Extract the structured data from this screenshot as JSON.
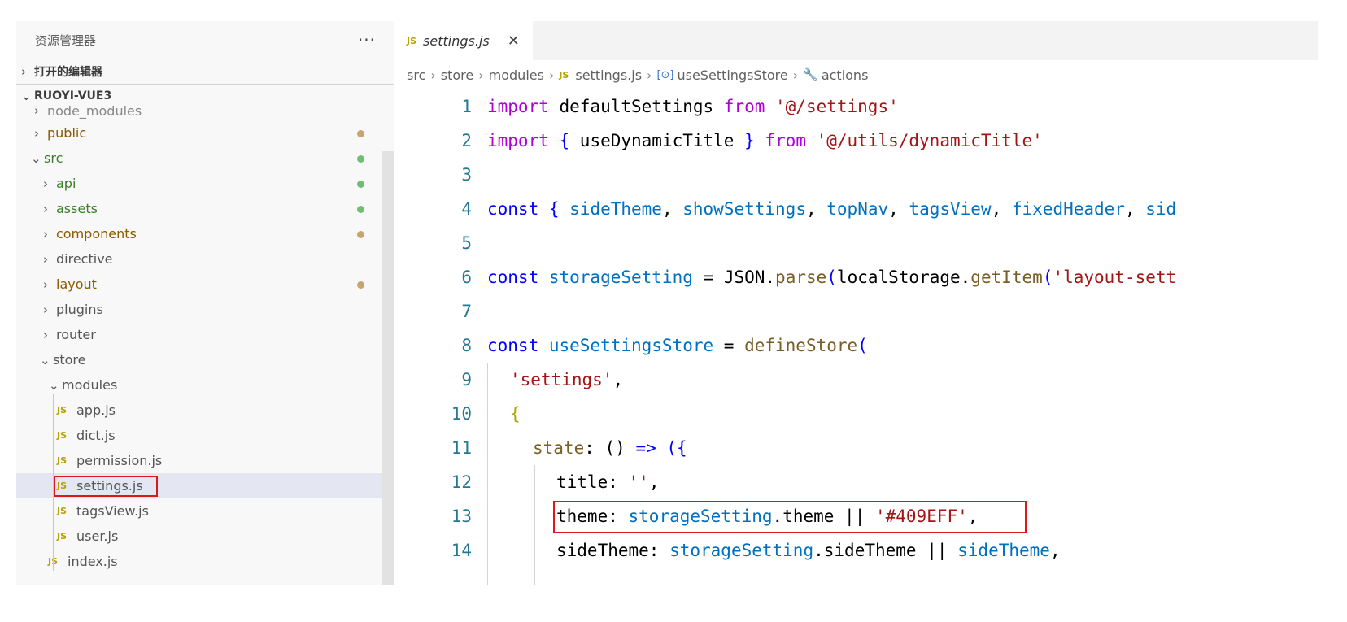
{
  "sidebar": {
    "title": "资源管理器",
    "more_label": "···",
    "open_editors_label": "打开的编辑器",
    "project_label": "RUOYI-VUE3",
    "tree": [
      {
        "label": "node_modules",
        "type": "folder",
        "expanded": false,
        "color": "dim"
      },
      {
        "label": "public",
        "type": "folder",
        "expanded": false,
        "color": "brown",
        "dot": "#c8a46e"
      },
      {
        "label": "src",
        "type": "folder",
        "expanded": true,
        "color": "green",
        "dot": "#6fbf73"
      },
      {
        "label": "api",
        "type": "folder",
        "expanded": false,
        "color": "green",
        "dot": "#6fbf73"
      },
      {
        "label": "assets",
        "type": "folder",
        "expanded": false,
        "color": "green",
        "dot": "#6fbf73"
      },
      {
        "label": "components",
        "type": "folder",
        "expanded": false,
        "color": "brown",
        "dot": "#c8a46e"
      },
      {
        "label": "directive",
        "type": "folder",
        "expanded": false,
        "color": "gray"
      },
      {
        "label": "layout",
        "type": "folder",
        "expanded": false,
        "color": "brown",
        "dot": "#c8a46e"
      },
      {
        "label": "plugins",
        "type": "folder",
        "expanded": false,
        "color": "gray"
      },
      {
        "label": "router",
        "type": "folder",
        "expanded": false,
        "color": "gray"
      },
      {
        "label": "store",
        "type": "folder",
        "expanded": true,
        "color": "gray"
      },
      {
        "label": "modules",
        "type": "folder",
        "expanded": true,
        "color": "gray"
      },
      {
        "label": "app.js",
        "type": "file",
        "color": "gray",
        "icon": "JS"
      },
      {
        "label": "dict.js",
        "type": "file",
        "color": "gray",
        "icon": "JS"
      },
      {
        "label": "permission.js",
        "type": "file",
        "color": "gray",
        "icon": "JS"
      },
      {
        "label": "settings.js",
        "type": "file",
        "color": "gray",
        "icon": "JS",
        "selected": true
      },
      {
        "label": "tagsView.js",
        "type": "file",
        "color": "gray",
        "icon": "JS"
      },
      {
        "label": "user.js",
        "type": "file",
        "color": "gray",
        "icon": "JS"
      },
      {
        "label": "index.js",
        "type": "file",
        "color": "gray",
        "icon": "JS"
      }
    ]
  },
  "editor": {
    "tab": {
      "icon": "JS",
      "label": "settings.js",
      "close": "✕"
    },
    "breadcrumb": {
      "items": [
        "src",
        "store",
        "modules",
        "settings.js",
        "useSettingsStore",
        "actions"
      ],
      "file_icon": "JS",
      "symbol_icon": "[⊙]",
      "wrench_icon": "🔧"
    },
    "lines": [
      {
        "n": "1"
      },
      {
        "n": "2"
      },
      {
        "n": "3"
      },
      {
        "n": "4"
      },
      {
        "n": "5"
      },
      {
        "n": "6"
      },
      {
        "n": "7"
      },
      {
        "n": "8"
      },
      {
        "n": "9"
      },
      {
        "n": "10"
      },
      {
        "n": "11"
      },
      {
        "n": "12"
      },
      {
        "n": "13"
      },
      {
        "n": "14"
      }
    ],
    "tokens": {
      "l1": [
        "import",
        " defaultSettings ",
        "from",
        " '@/settings'"
      ],
      "l2": [
        "import",
        " { ",
        "useDynamicTitle",
        " } ",
        "from",
        " '@/utils/dynamicTitle'"
      ],
      "l4": [
        "const",
        " { ",
        "sideTheme",
        ", ",
        "showSettings",
        ", ",
        "topNav",
        ", ",
        "tagsView",
        ", ",
        "fixedHeader",
        ", ",
        "sid"
      ],
      "l6": [
        "const",
        " storageSetting ",
        "= ",
        "JSON",
        ".",
        "parse",
        "(",
        "localStorage",
        ".",
        "getItem",
        "(",
        "'layout-sett"
      ],
      "l8": [
        "const",
        " useSettingsStore ",
        "= ",
        "defineStore",
        "("
      ],
      "l9": [
        "'settings'",
        ","
      ],
      "l10": [
        "{"
      ],
      "l11": [
        "state",
        ": () ",
        "=>",
        " ({"
      ],
      "l12": [
        "title",
        ": ",
        "''",
        ","
      ],
      "l13": [
        "theme",
        ": ",
        "storageSetting",
        ".",
        "theme",
        " || ",
        "'#409EFF'",
        ","
      ],
      "l14": [
        "sideTheme",
        ": ",
        "storageSetting",
        ".",
        "sideTheme",
        " || ",
        "sideTheme",
        ","
      ]
    }
  }
}
